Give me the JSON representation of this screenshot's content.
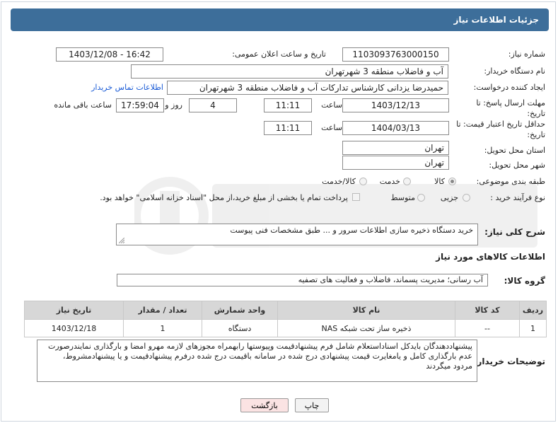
{
  "header": {
    "title": "جزئیات اطلاعات نیاز"
  },
  "fields": {
    "need_number_label": "شماره نیاز:",
    "need_number": "1103093763000150",
    "announce_label": "تاریخ و ساعت اعلان عمومی:",
    "announce_value": "1403/12/08 - 16:42",
    "buyer_org_label": "نام دستگاه خریدار:",
    "buyer_org": "آب و فاضلاب منطقه 3 شهرتهران",
    "creator_label": "ایجاد کننده درخواست:",
    "creator": "حمیدرضا یزدانی کارشناس تدارکات آب و فاضلاب منطقه 3 شهرتهران",
    "contact_link": "اطلاعات تماس خریدار",
    "deadline_label": "مهلت ارسال پاسخ: تا تاریخ:",
    "deadline_date": "1403/12/13",
    "time_label": "ساعت",
    "deadline_time": "11:11",
    "days_value": "4",
    "days_label": "روز و",
    "remaining_time": "17:59:04",
    "remaining_label": "ساعت باقی مانده",
    "validity_label": "حداقل تاریخ اعتبار قیمت: تا تاریخ:",
    "validity_date": "1404/03/13",
    "validity_time": "11:11",
    "province_label": "استان محل تحویل:",
    "province": "تهران",
    "city_label": "شهر محل تحویل:",
    "city": "تهران",
    "category_label": "طبقه بندی موضوعی:",
    "category_options": [
      "کالا",
      "خدمت",
      "کالا/خدمت"
    ],
    "category_selected": "کالا",
    "process_label": "نوع فرآیند خرید :",
    "process_options": [
      "جزیی",
      "متوسط"
    ],
    "payment_text": "پرداخت تمام یا بخشی از مبلغ خرید،از محل \"اسناد خزانه اسلامی\" خواهد بود."
  },
  "description": {
    "label": "شرح کلی نیاز:",
    "text": "خرید دستگاه ذخیره سازی اطلاعات سرور و ... طبق مشخصات فنی پیوست"
  },
  "goods_section": {
    "title": "اطلاعات کالاهای مورد نیاز"
  },
  "goods_group": {
    "label": "گروه کالا:",
    "value": "آب رسانی؛ مدیریت پسماند، فاضلاب و فعالیت های تصفیه"
  },
  "table": {
    "headers": [
      "ردیف",
      "کد کالا",
      "نام کالا",
      "واحد شمارش",
      "تعداد / مقدار",
      "تاریخ نیاز"
    ],
    "rows": [
      [
        "1",
        "--",
        "ذخیره ساز تحت شبکه NAS",
        "دستگاه",
        "1",
        "1403/12/18"
      ]
    ]
  },
  "buyer_notes": {
    "label": "توضیحات خریدار:",
    "text": "پیشنهاددهندگان بایدکل اسناداستعلام شامل فرم پیشنهادقیمت وپیوستها رابهمراه مجوزهای لازمه مهرو امضا و بارگذاری نمایندرصورت عدم بارگذاری کامل و یامغایرت قیمت پیشنهادی درج شده در سامانه باقیمت درج شده درفرم پیشنهادقیمت و یا پیشنهادمشروط، مردود میگردند"
  },
  "buttons": {
    "print": "چاپ",
    "back": "بازگشت"
  },
  "colors": {
    "header_bg": "#3d6e9a",
    "link": "#1a5bd6",
    "back_btn_bg": "#fbe3e3",
    "table_header_bg": "#d7d7d7"
  }
}
